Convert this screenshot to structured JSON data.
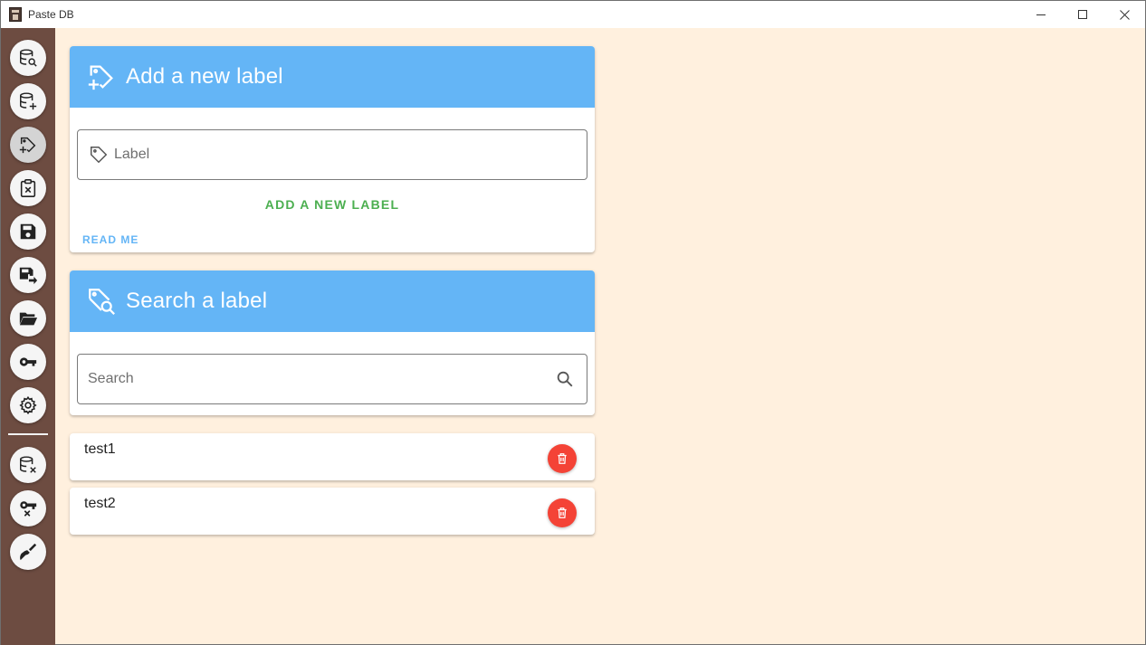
{
  "window": {
    "title": "Paste DB"
  },
  "sidebar": {
    "items": [
      {
        "name": "search-database",
        "icon": "database-search-icon"
      },
      {
        "name": "add-database",
        "icon": "database-plus-icon"
      },
      {
        "name": "add-label",
        "icon": "tag-plus-icon",
        "active": true
      },
      {
        "name": "clipboard-remove",
        "icon": "clipboard-remove-icon"
      },
      {
        "name": "save",
        "icon": "content-save-icon"
      },
      {
        "name": "save-move",
        "icon": "content-save-move-icon"
      },
      {
        "name": "open-folder",
        "icon": "folder-open-icon"
      },
      {
        "name": "key",
        "icon": "key-icon"
      },
      {
        "name": "settings",
        "icon": "cog-icon"
      },
      {
        "name": "remove-database",
        "icon": "database-remove-icon"
      },
      {
        "name": "remove-key",
        "icon": "key-remove-icon"
      },
      {
        "name": "clean",
        "icon": "broom-icon"
      }
    ]
  },
  "add_label_card": {
    "title": "Add a new label",
    "input_placeholder": "Label",
    "submit_label": "ADD A NEW LABEL",
    "readme_label": "READ ME"
  },
  "search_card": {
    "title": "Search a label",
    "input_placeholder": "Search"
  },
  "labels": [
    {
      "text": "test1"
    },
    {
      "text": "test2"
    }
  ],
  "colors": {
    "sidebar": "#6d4c41",
    "background": "#fff0de",
    "header": "#64b5f6",
    "accent_green": "#4caf50",
    "delete_red": "#f44336"
  }
}
